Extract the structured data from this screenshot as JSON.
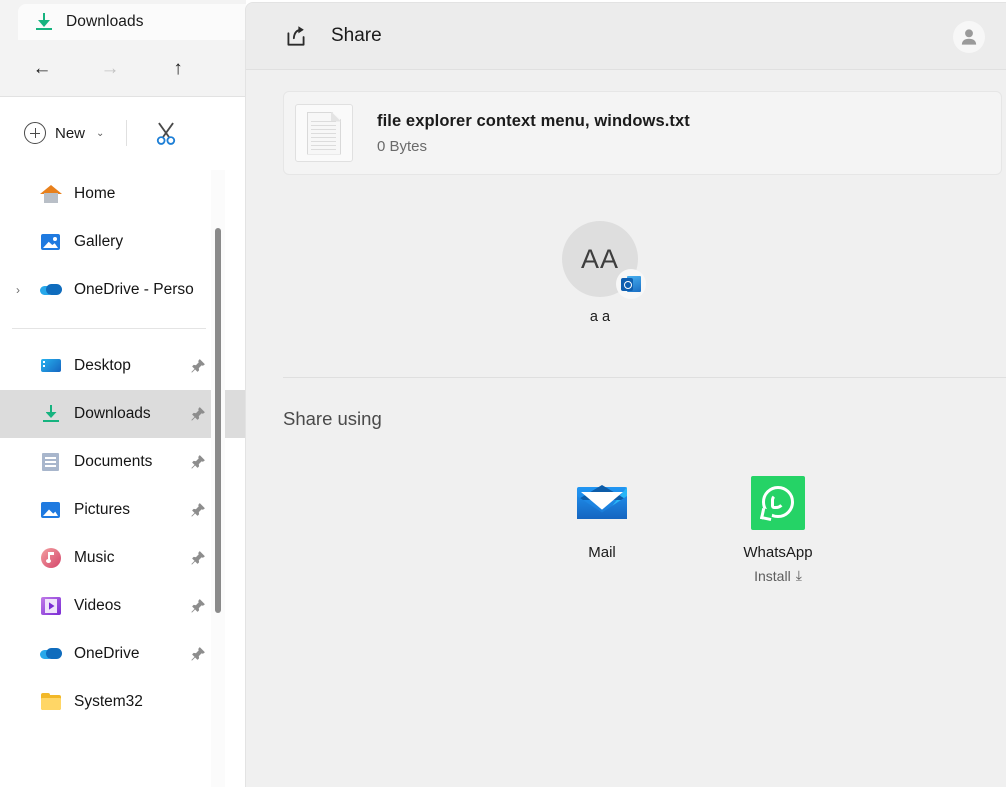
{
  "explorer": {
    "tab": {
      "label": "Downloads",
      "icon": "downloads-icon"
    },
    "nav": {
      "back": "←",
      "forward": "→",
      "up": "↑"
    },
    "toolbar": {
      "new_label": "New",
      "new_chevron": "⌄",
      "cut_icon": "scissors-icon"
    },
    "sidebar": {
      "items": [
        {
          "label": "Home",
          "icon": "home-icon",
          "pinned": false,
          "expander": false,
          "selected": false
        },
        {
          "label": "Gallery",
          "icon": "gallery-icon",
          "pinned": false,
          "expander": false,
          "selected": false
        },
        {
          "label": "OneDrive - Perso",
          "icon": "onedrive-icon",
          "pinned": false,
          "expander": true,
          "selected": false
        },
        {
          "label": "Desktop",
          "icon": "desktop-icon",
          "pinned": true,
          "expander": false,
          "selected": false
        },
        {
          "label": "Downloads",
          "icon": "downloads-icon",
          "pinned": true,
          "expander": false,
          "selected": true
        },
        {
          "label": "Documents",
          "icon": "documents-icon",
          "pinned": true,
          "expander": false,
          "selected": false
        },
        {
          "label": "Pictures",
          "icon": "pictures-icon",
          "pinned": true,
          "expander": false,
          "selected": false
        },
        {
          "label": "Music",
          "icon": "music-icon",
          "pinned": true,
          "expander": false,
          "selected": false
        },
        {
          "label": "Videos",
          "icon": "videos-icon",
          "pinned": true,
          "expander": false,
          "selected": false
        },
        {
          "label": "OneDrive",
          "icon": "onedrive-icon",
          "pinned": true,
          "expander": false,
          "selected": false
        },
        {
          "label": "System32",
          "icon": "folder-icon",
          "pinned": false,
          "expander": false,
          "selected": false
        }
      ],
      "pin_glyph": "📌"
    }
  },
  "share": {
    "header": {
      "title": "Share",
      "icon": "share-icon",
      "account_icon": "account-avatar-icon"
    },
    "file": {
      "name": "file explorer context menu, windows.txt",
      "size": "0 Bytes",
      "icon": "text-file-icon"
    },
    "contacts": [
      {
        "initials": "AA",
        "name": "a a",
        "app_badge": "outlook-icon"
      }
    ],
    "share_using": {
      "title": "Share using",
      "apps": [
        {
          "name": "Mail",
          "icon": "mail-icon",
          "sub": "",
          "sub_icon": ""
        },
        {
          "name": "WhatsApp",
          "icon": "whatsapp-icon",
          "sub": "Install",
          "sub_icon": "⤓"
        }
      ]
    }
  },
  "colors": {
    "accent_green": "#16b37f",
    "whatsapp_green": "#25d366",
    "mail_blue": "#1976d2",
    "panel_bg": "#f0f0f0",
    "selected_row": "#dcdcdc"
  }
}
